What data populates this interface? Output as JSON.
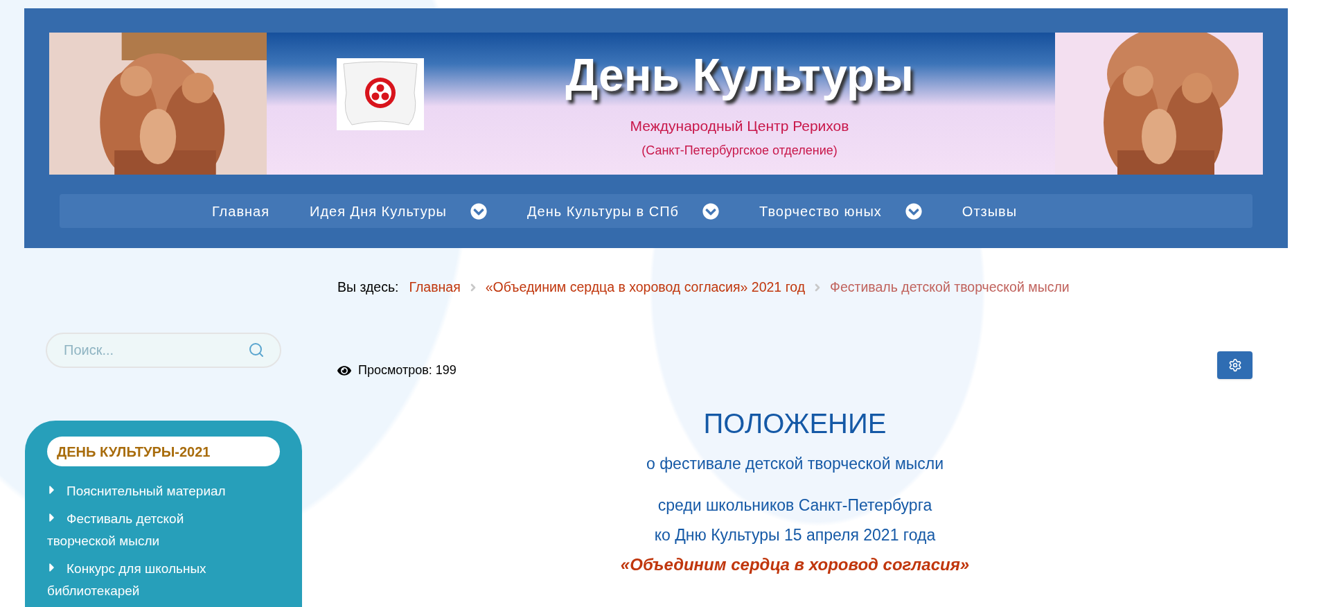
{
  "banner": {
    "title": "День Культуры",
    "subtitle": "Международный Центр Рерихов",
    "subtitle_2": "(Санкт-Петербургское отделение)"
  },
  "nav": [
    {
      "label": "Главная",
      "has_submenu": false
    },
    {
      "label": "Идея Дня Культуры",
      "has_submenu": true
    },
    {
      "label": "День Культуры в СПб",
      "has_submenu": true
    },
    {
      "label": "Творчество юных",
      "has_submenu": true
    },
    {
      "label": "Отзывы",
      "has_submenu": false
    }
  ],
  "breadcrumb": {
    "label": "Вы здесь:",
    "items": [
      {
        "text": "Главная",
        "current": false
      },
      {
        "text": "«Объединим сердца в хоровод согласия» 2021 год",
        "current": false
      },
      {
        "text": "Фестиваль детской творческой мысли",
        "current": true
      }
    ]
  },
  "search": {
    "placeholder": "Поиск..."
  },
  "views": "Просмотров: 199",
  "sidebar": {
    "title": "ДЕНЬ КУЛЬТУРЫ-2021",
    "items": [
      "Пояснительный материал",
      "Фестиваль детской творческой мысли",
      "Конкурс для школьных библиотекарей"
    ]
  },
  "article": {
    "heading": "ПОЛОЖЕНИЕ",
    "subtitle": "о фестивале детской творческой мысли",
    "lines": [
      "среди школьников Санкт-Петербурга",
      "ко Дню Культуры 15 апреля 2021 года"
    ],
    "motto": "«Объединим сердца в хоровод согласия»"
  }
}
